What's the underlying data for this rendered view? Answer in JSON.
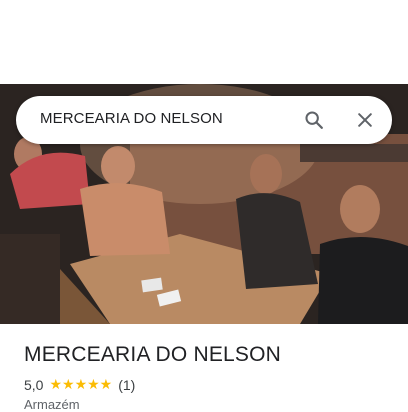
{
  "search": {
    "query": "MERCEARIA DO NELSON"
  },
  "icons": {
    "search": "search-icon",
    "close": "close-icon",
    "star": "star-icon"
  },
  "place": {
    "name": "MERCEARIA DO NELSON",
    "rating": "5,0",
    "stars": "★★★★★",
    "review_count": "(1)",
    "category": "Armazém"
  },
  "colors": {
    "star": "#fbbc04",
    "icon": "#5f6368",
    "text": "#202124"
  }
}
